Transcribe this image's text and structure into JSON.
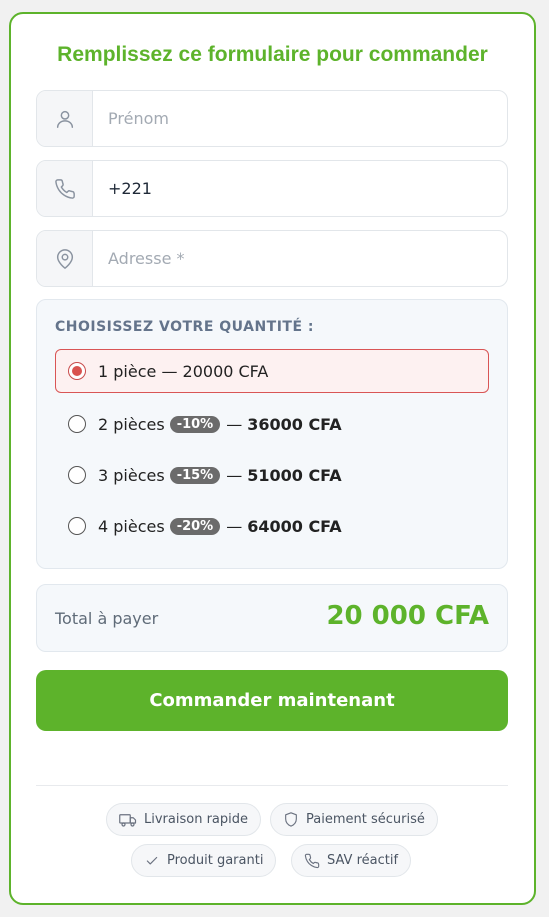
{
  "form": {
    "title": "Remplissez ce formulaire pour commander",
    "fields": {
      "first_name": {
        "placeholder": "Prénom",
        "value": ""
      },
      "phone": {
        "placeholder": "",
        "value": "+221"
      },
      "address": {
        "placeholder": "Adresse *",
        "value": ""
      }
    }
  },
  "quantity": {
    "title": "CHOISISSEZ VOTRE QUANTITÉ :",
    "options": [
      {
        "label": "1 pièce — 20000 CFA",
        "selected": true
      },
      {
        "label": "2 pièces",
        "discount": "-10%",
        "sep": "—",
        "price": "36000 CFA",
        "selected": false
      },
      {
        "label": "3 pièces",
        "discount": "-15%",
        "sep": "—",
        "price": "51000 CFA",
        "selected": false
      },
      {
        "label": "4 pièces",
        "discount": "-20%",
        "sep": "—",
        "price": "64000 CFA",
        "selected": false
      }
    ]
  },
  "total": {
    "label": "Total à payer",
    "amount": "20 000 CFA"
  },
  "cta": {
    "label": "Commander maintenant"
  },
  "badges": [
    {
      "label": "Livraison rapide",
      "icon": "truck-icon"
    },
    {
      "label": "Paiement sécurisé",
      "icon": "shield-icon"
    },
    {
      "label": "Produit garanti",
      "icon": "check-icon"
    },
    {
      "label": "SAV réactif",
      "icon": "phone-icon"
    }
  ],
  "colors": {
    "accent": "#5db32b",
    "selected_border": "#d95555",
    "selected_bg": "#fdf1f1",
    "badge_bg": "#6b6b6b"
  }
}
